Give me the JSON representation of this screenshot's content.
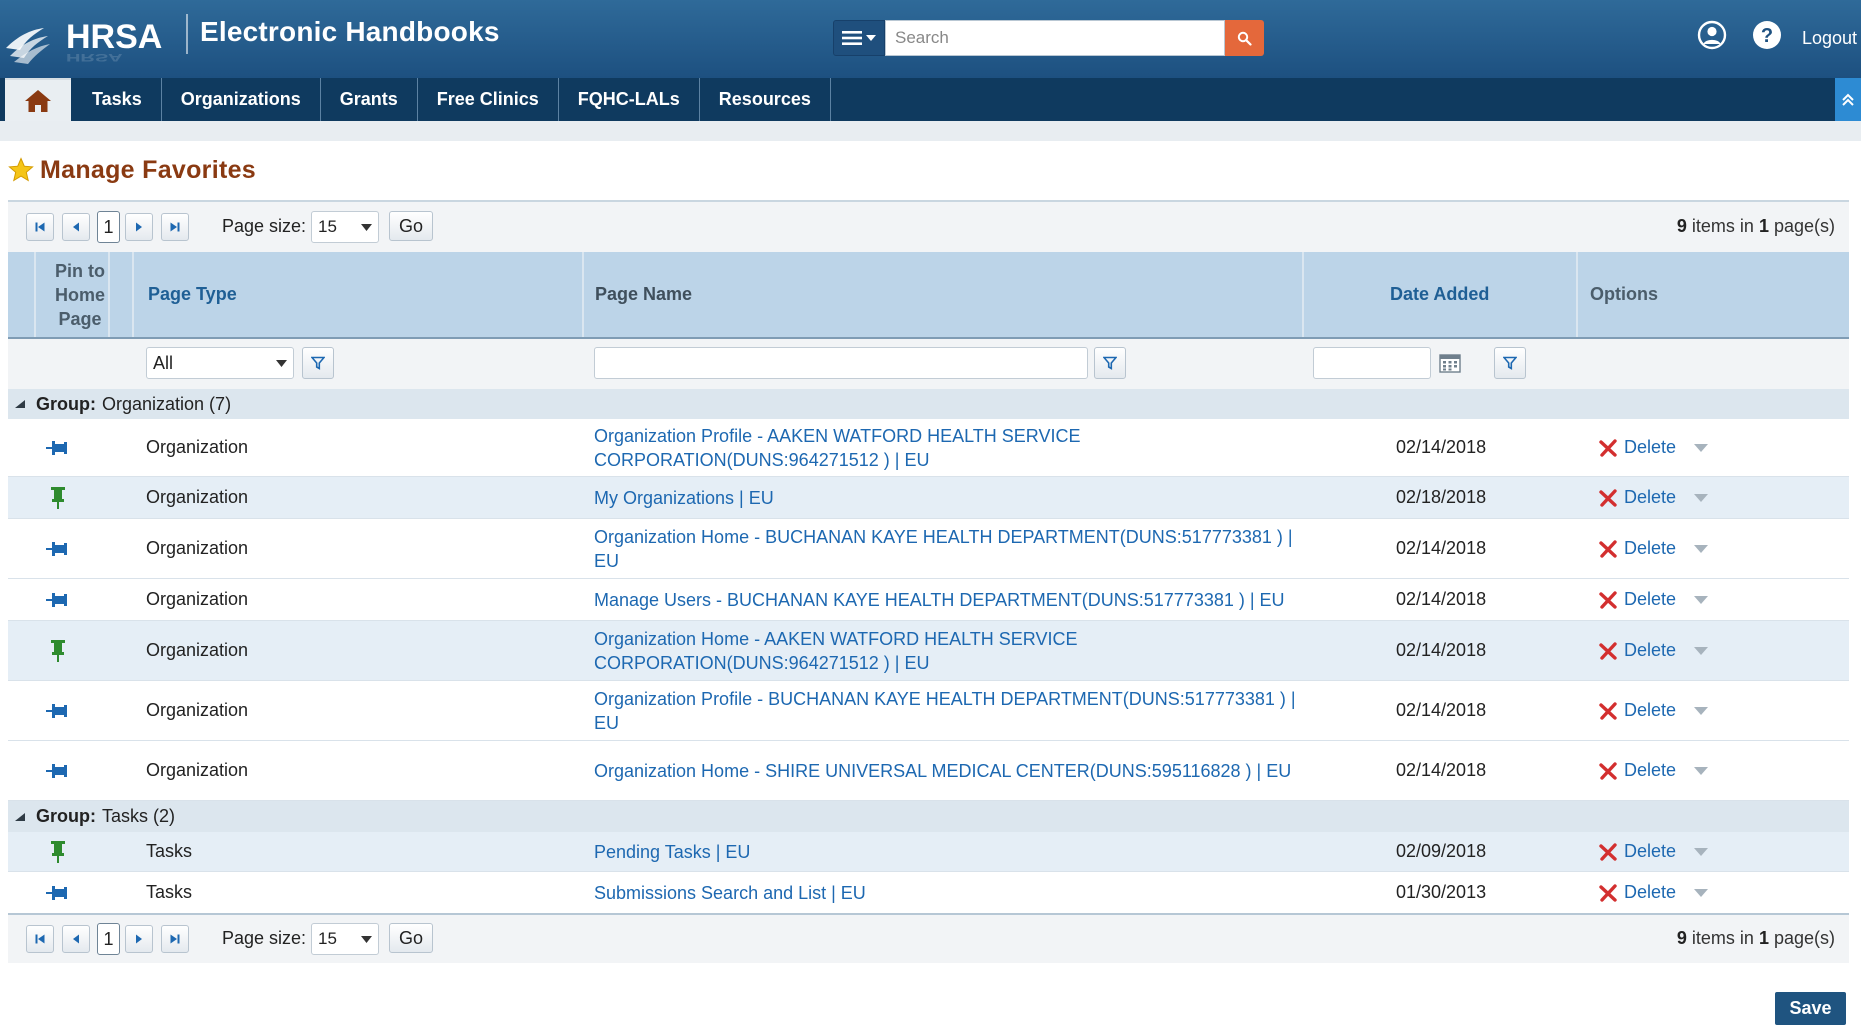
{
  "header": {
    "logo_text": "HRSA",
    "app_title": "Electronic Handbooks",
    "search_placeholder": "Search",
    "logout_label": "Logout"
  },
  "nav": {
    "items": [
      "Tasks",
      "Organizations",
      "Grants",
      "Free Clinics",
      "FQHC-LALs",
      "Resources"
    ]
  },
  "page": {
    "title": "Manage Favorites"
  },
  "pager": {
    "current_page": "1",
    "page_size_label": "Page size:",
    "page_size": "15",
    "go_label": "Go",
    "items_count": "9",
    "items_text": " items in ",
    "pages_count": "1",
    "pages_text": " page(s)"
  },
  "columns": {
    "pin": "Pin to Home Page",
    "page_type": "Page Type",
    "page_name": "Page Name",
    "date_added": "Date Added",
    "options": "Options"
  },
  "filters": {
    "page_type_value": "All"
  },
  "groups": [
    {
      "label": "Group:",
      "name": " Organization (7)",
      "rows": [
        {
          "pinned": false,
          "type": "Organization",
          "name": "Organization Profile - AAKEN WATFORD HEALTH SERVICE CORPORATION(DUNS:964271512 ) | EU",
          "date": "02/14/2018",
          "action": "Delete"
        },
        {
          "pinned": true,
          "type": "Organization",
          "name": "My Organizations | EU",
          "date": "02/18/2018",
          "action": "Delete"
        },
        {
          "pinned": false,
          "type": "Organization",
          "name": "Organization Home - BUCHANAN KAYE HEALTH DEPARTMENT(DUNS:517773381 ) | EU",
          "date": "02/14/2018",
          "action": "Delete"
        },
        {
          "pinned": false,
          "type": "Organization",
          "name": "Manage Users - BUCHANAN KAYE HEALTH DEPARTMENT(DUNS:517773381 ) | EU",
          "date": "02/14/2018",
          "action": "Delete"
        },
        {
          "pinned": true,
          "type": "Organization",
          "name": "Organization Home - AAKEN WATFORD HEALTH SERVICE CORPORATION(DUNS:964271512 ) | EU",
          "date": "02/14/2018",
          "action": "Delete"
        },
        {
          "pinned": false,
          "type": "Organization",
          "name": "Organization Profile - BUCHANAN KAYE HEALTH DEPARTMENT(DUNS:517773381 ) | EU",
          "date": "02/14/2018",
          "action": "Delete"
        },
        {
          "pinned": false,
          "type": "Organization",
          "name": "Organization Home - SHIRE UNIVERSAL MEDICAL CENTER(DUNS:595116828 ) | EU",
          "date": "02/14/2018",
          "action": "Delete"
        }
      ]
    },
    {
      "label": "Group:",
      "name": " Tasks (2)",
      "rows": [
        {
          "pinned": true,
          "type": "Tasks",
          "name": "Pending Tasks | EU",
          "date": "02/09/2018",
          "action": "Delete"
        },
        {
          "pinned": false,
          "type": "Tasks",
          "name": "Submissions Search and List | EU",
          "date": "01/30/2013",
          "action": "Delete"
        }
      ]
    }
  ],
  "actions": {
    "save_label": "Save"
  },
  "colors": {
    "header_blue": "#1d5080",
    "nav_navy": "#0f3a5f",
    "accent_orange": "#e4683b",
    "link_blue": "#1d68b1",
    "title_brown": "#8a3a12",
    "pin_green": "#2e8b2e",
    "pin_blue": "#1d68b1",
    "delete_red": "#d32f2f"
  }
}
